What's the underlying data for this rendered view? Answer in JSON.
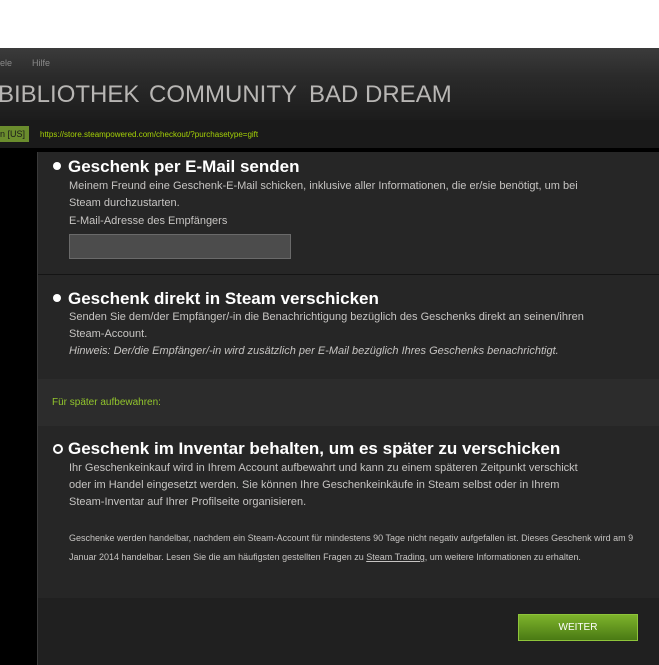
{
  "menubar": {
    "items": [
      "iele",
      "Hilfe"
    ]
  },
  "mainnav": {
    "items": [
      "BIBLIOTHEK",
      "COMMUNITY",
      "BAD DREAM"
    ]
  },
  "urlbar": {
    "lang_badge": "n [US]",
    "url": "https://store.steampowered.com/checkout/?purchasetype=gift"
  },
  "option_email": {
    "heading": "Geschenk per E-Mail senden",
    "desc_line1": "Meinem Freund eine Geschenk-E-Mail schicken, inklusive aller Informationen, die er/sie benötigt, um bei",
    "desc_line2": "Steam durchzustarten.",
    "field_label": "E-Mail-Adresse des Empfängers",
    "field_value": ""
  },
  "option_direct": {
    "heading": "Geschenk direkt in Steam verschicken",
    "desc_line1": "Senden Sie dem/der Empfänger/-in die Benachrichtigung bezüglich des Geschenks direkt an seinen/ihren",
    "desc_line2": "Steam-Account.",
    "hint": "Hinweis: Der/die Empfänger/-in wird zusätzlich per E-Mail bezüglich Ihres Geschenks benachrichtigt."
  },
  "later": {
    "label": "Für später aufbewahren:"
  },
  "option_inventory": {
    "heading": "Geschenk im Inventar behalten, um es später zu verschicken",
    "desc_line1": "Ihr Geschenkeinkauf wird in Ihrem Account aufbewahrt und kann zu einem späteren Zeitpunkt verschickt",
    "desc_line2": "oder im Handel eingesetzt werden. Sie können Ihre Geschenkeinkäufe in Steam selbst oder in Ihrem",
    "desc_line3": "Steam-Inventar auf Ihrer Profilseite organisieren.",
    "note_before": "Geschenke werden handelbar, nachdem ein Steam-Account für mindestens 90 Tage nicht negativ aufgefallen ist. Dieses Geschenk wird am 9 Januar 2014 handelbar. Lesen Sie die am häufigsten gestellten Fragen zu ",
    "note_link": "Steam Trading",
    "note_after": ", um weitere Informationen zu erhalten."
  },
  "footer": {
    "continue_label": "WEITER"
  }
}
